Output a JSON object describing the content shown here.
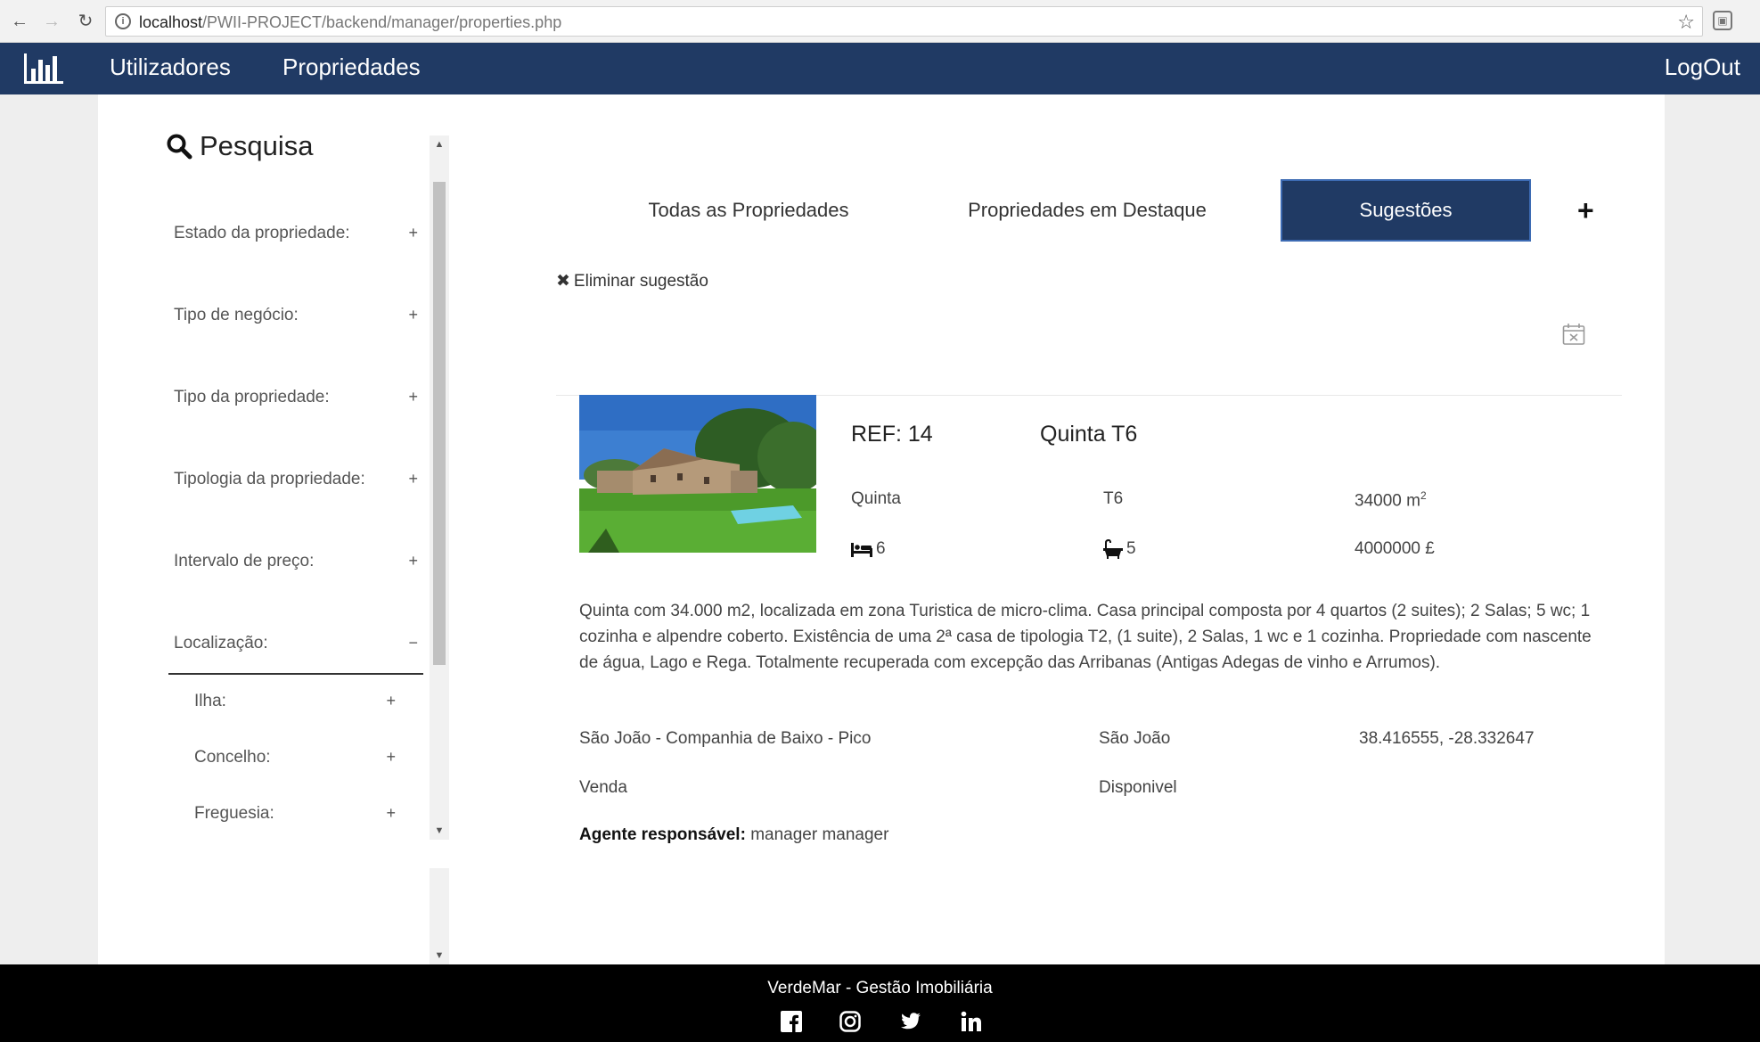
{
  "browser": {
    "url_host": "localhost",
    "url_path": "/PWII-PROJECT/backend/manager/properties.php"
  },
  "navbar": {
    "items": [
      {
        "label": "Utilizadores"
      },
      {
        "label": "Propriedades"
      }
    ],
    "logout_label": "LogOut",
    "logo_icon": "bar-chart-icon"
  },
  "sidebar": {
    "title": "Pesquisa",
    "filters": [
      {
        "label": "Estado da propriedade:",
        "toggle": "+"
      },
      {
        "label": "Tipo de negócio:",
        "toggle": "+"
      },
      {
        "label": "Tipo da propriedade:",
        "toggle": "+"
      },
      {
        "label": "Tipologia da propriedade:",
        "toggle": "+"
      },
      {
        "label": "Intervalo de preço:",
        "toggle": "+"
      }
    ],
    "location": {
      "label": "Localização:",
      "toggle": "−"
    },
    "subfilters": [
      {
        "label": "Ilha:",
        "toggle": "+"
      },
      {
        "label": "Concelho:",
        "toggle": "+"
      },
      {
        "label": "Freguesia:",
        "toggle": "+"
      }
    ]
  },
  "tabs": [
    {
      "label": "Todas as Propriedades"
    },
    {
      "label": "Propriedades em Destaque"
    },
    {
      "label": "Sugestões"
    }
  ],
  "add_label": "+",
  "delete_suggestion_label": "Eliminar sugestão",
  "property": {
    "ref": "REF: 14",
    "title": "Quinta T6",
    "type": "Quinta",
    "typology": "T6",
    "area": "34000 m",
    "area_unit_sup": "2",
    "bedrooms": "6",
    "bathrooms": "5",
    "price": "4000000 £",
    "description": "Quinta com 34.000 m2, localizada em zona Turistica de micro-clima. Casa principal composta por 4 quartos (2 suites); 2 Salas; 5 wc; 1 cozinha e alpendre coberto. Existência de uma 2ª casa de tipologia T2, (1 suite), 2 Salas, 1 wc e 1 cozinha. Propriedade com nascente de água, Lago e Rega. Totalmente recuperada com excepção das Arribanas (Antigas Adegas de vinho e Arrumos).",
    "address": "São João - Companhia de Baixo - Pico",
    "parish": "São João",
    "coordinates": "38.416555, -28.332647",
    "deal": "Venda",
    "status": "Disponivel",
    "agent_label": "Agente responsável:",
    "agent_name": "manager manager"
  },
  "footer": {
    "text": "VerdeMar - Gestão Imobiliária",
    "social_icons": [
      "facebook-icon",
      "instagram-icon",
      "twitter-icon",
      "linkedin-icon"
    ]
  },
  "colors": {
    "navbar": "#203a64",
    "footer": "#000000",
    "active_tab": "#203a64"
  }
}
